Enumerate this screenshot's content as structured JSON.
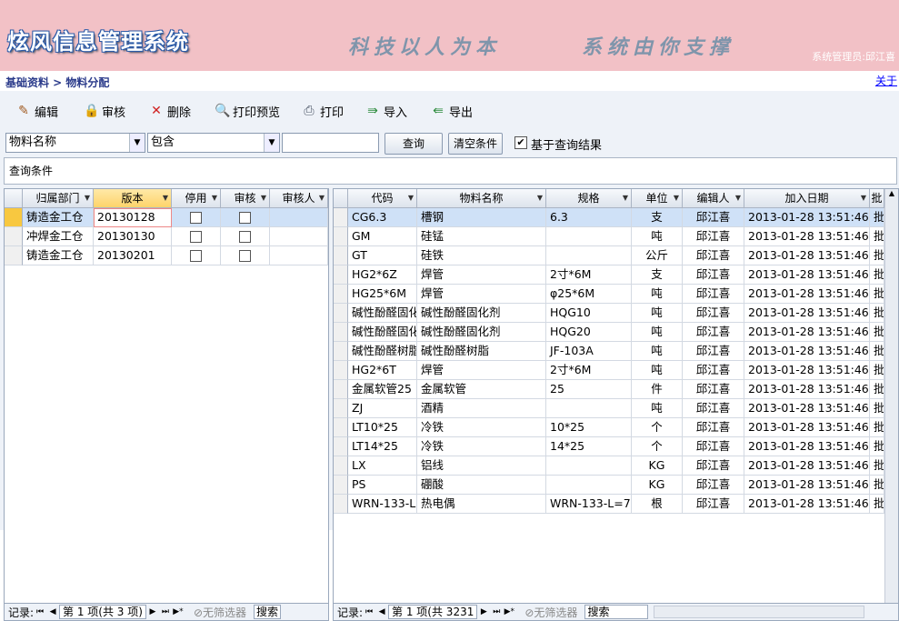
{
  "app": {
    "title": "炫风信息管理系统",
    "slogan_left": "科技以人为本",
    "slogan_right": "系统由你支撑",
    "admin_label": "系统管理员:",
    "admin_name": "邱江喜"
  },
  "breadcrumb": {
    "text": "基础资料 > 物料分配"
  },
  "about_link": "关于",
  "toolbar": {
    "edit": "编辑",
    "audit": "审核",
    "delete": "删除",
    "print_preview": "打印预览",
    "print": "打印",
    "import": "导入",
    "export": "导出"
  },
  "filter": {
    "field": "物料名称",
    "operator": "包含",
    "value": "",
    "query_button": "查询",
    "clear_button": "清空条件",
    "based_on_result_label": "基于查询结果",
    "based_on_result_checked": true
  },
  "query_conditions_label": "查询条件",
  "left_grid": {
    "columns": [
      "归属部门",
      "版本",
      "停用",
      "审核",
      "审核人"
    ],
    "rows": [
      {
        "dept": "铸造金工仓",
        "version": "20130128",
        "disabled": false,
        "audited": false,
        "auditor": ""
      },
      {
        "dept": "冲焊金工仓",
        "version": "20130130",
        "disabled": false,
        "audited": false,
        "auditor": ""
      },
      {
        "dept": "铸造金工仓",
        "version": "20130201",
        "disabled": false,
        "audited": false,
        "auditor": ""
      }
    ],
    "nav": {
      "record_label": "记录:",
      "position": "第 1 项(共 3 项)",
      "no_filter": "无筛选器",
      "search": "搜索"
    }
  },
  "right_grid": {
    "columns": [
      "代码",
      "物料名称",
      "规格",
      "单位",
      "编辑人",
      "加入日期",
      "批"
    ],
    "rows": [
      {
        "code": "CG6.3",
        "name": "槽钢",
        "spec": "6.3",
        "unit": "支",
        "editor": "邱江喜",
        "date": "2013-01-28 13:51:46",
        "extra": "批"
      },
      {
        "code": "GM",
        "name": "硅锰",
        "spec": "",
        "unit": "吨",
        "editor": "邱江喜",
        "date": "2013-01-28 13:51:46",
        "extra": "批"
      },
      {
        "code": "GT",
        "name": "硅铁",
        "spec": "",
        "unit": "公斤",
        "editor": "邱江喜",
        "date": "2013-01-28 13:51:46",
        "extra": "批"
      },
      {
        "code": "HG2*6Z",
        "name": "焊管",
        "spec": "2寸*6M",
        "unit": "支",
        "editor": "邱江喜",
        "date": "2013-01-28 13:51:46",
        "extra": "批"
      },
      {
        "code": "HG25*6M",
        "name": "焊管",
        "spec": "φ25*6M",
        "unit": "吨",
        "editor": "邱江喜",
        "date": "2013-01-28 13:51:46",
        "extra": "批"
      },
      {
        "code": "碱性酚醛固化",
        "name": "碱性酚醛固化剂",
        "spec": "HQG10",
        "unit": "吨",
        "editor": "邱江喜",
        "date": "2013-01-28 13:51:46",
        "extra": "批"
      },
      {
        "code": "碱性酚醛固化",
        "name": "碱性酚醛固化剂",
        "spec": "HQG20",
        "unit": "吨",
        "editor": "邱江喜",
        "date": "2013-01-28 13:51:46",
        "extra": "批"
      },
      {
        "code": "碱性酚醛树脂",
        "name": "碱性酚醛树脂",
        "spec": "JF-103A",
        "unit": "吨",
        "editor": "邱江喜",
        "date": "2013-01-28 13:51:46",
        "extra": "批"
      },
      {
        "code": "HG2*6T",
        "name": "焊管",
        "spec": "2寸*6M",
        "unit": "吨",
        "editor": "邱江喜",
        "date": "2013-01-28 13:51:46",
        "extra": "批"
      },
      {
        "code": "金属软管25",
        "name": "金属软管",
        "spec": "25",
        "unit": "件",
        "editor": "邱江喜",
        "date": "2013-01-28 13:51:46",
        "extra": "批"
      },
      {
        "code": "ZJ",
        "name": "酒精",
        "spec": "",
        "unit": "吨",
        "editor": "邱江喜",
        "date": "2013-01-28 13:51:46",
        "extra": "批"
      },
      {
        "code": "LT10*25",
        "name": "冷铁",
        "spec": "10*25",
        "unit": "个",
        "editor": "邱江喜",
        "date": "2013-01-28 13:51:46",
        "extra": "批"
      },
      {
        "code": "LT14*25",
        "name": "冷铁",
        "spec": "14*25",
        "unit": "个",
        "editor": "邱江喜",
        "date": "2013-01-28 13:51:46",
        "extra": "批"
      },
      {
        "code": "LX",
        "name": "铝线",
        "spec": "",
        "unit": "KG",
        "editor": "邱江喜",
        "date": "2013-01-28 13:51:46",
        "extra": "批"
      },
      {
        "code": "PS",
        "name": "硼酸",
        "spec": "",
        "unit": "KG",
        "editor": "邱江喜",
        "date": "2013-01-28 13:51:46",
        "extra": "批"
      },
      {
        "code": "WRN-133-L",
        "name": "热电偶",
        "spec": "WRN-133-L=7",
        "unit": "根",
        "editor": "邱江喜",
        "date": "2013-01-28 13:51:46",
        "extra": "批"
      }
    ],
    "nav": {
      "record_label": "记录:",
      "position": "第 1 项(共 3231",
      "no_filter": "无筛选器",
      "search": "搜索"
    }
  }
}
